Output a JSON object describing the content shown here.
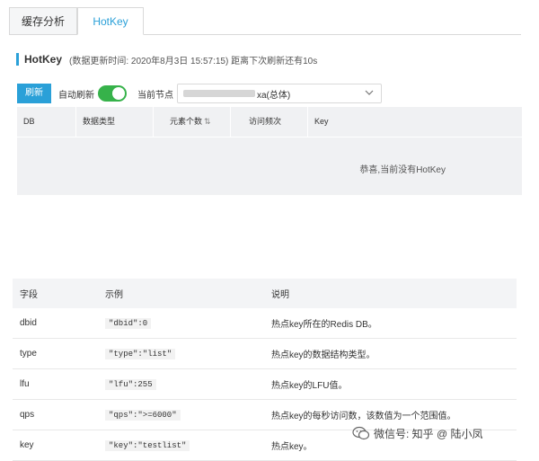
{
  "tabs": [
    {
      "label": "缓存分析"
    },
    {
      "label": "HotKey"
    }
  ],
  "header": {
    "title": "HotKey",
    "subtitle": "(数据更新时间: 2020年8月3日 15:57:15) 距离下次刷新还有10s"
  },
  "toolbar": {
    "refresh_label": "刷新",
    "auto_refresh_label": "自动刷新",
    "auto_refresh_on": true,
    "node_label": "当前节点",
    "node_value_suffix": "xa(总体)"
  },
  "hotkey_table": {
    "columns": [
      "DB",
      "数据类型",
      "元素个数",
      "访问频次",
      "Key"
    ],
    "empty_text": "恭喜,当前没有HotKey"
  },
  "field_table": {
    "columns": [
      "字段",
      "示例",
      "说明"
    ],
    "rows": [
      {
        "field": "dbid",
        "example": "\"dbid\":0",
        "desc": "热点key所在的Redis DB。"
      },
      {
        "field": "type",
        "example": "\"type\":\"list\"",
        "desc": "热点key的数据结构类型。"
      },
      {
        "field": "lfu",
        "example": "\"lfu\":255",
        "desc": "热点key的LFU值。"
      },
      {
        "field": "qps",
        "example": "\"qps\":\">=6000\"",
        "desc": "热点key的每秒访问数，该数值为一个范围值。"
      },
      {
        "field": "key",
        "example": "\"key\":\"testlist\"",
        "desc": "热点key。"
      }
    ]
  },
  "watermark": {
    "text": "微信号: 知乎 @ 陆小凤"
  },
  "colors": {
    "accent": "#2aa0d8",
    "switch_on": "#36b24a"
  }
}
